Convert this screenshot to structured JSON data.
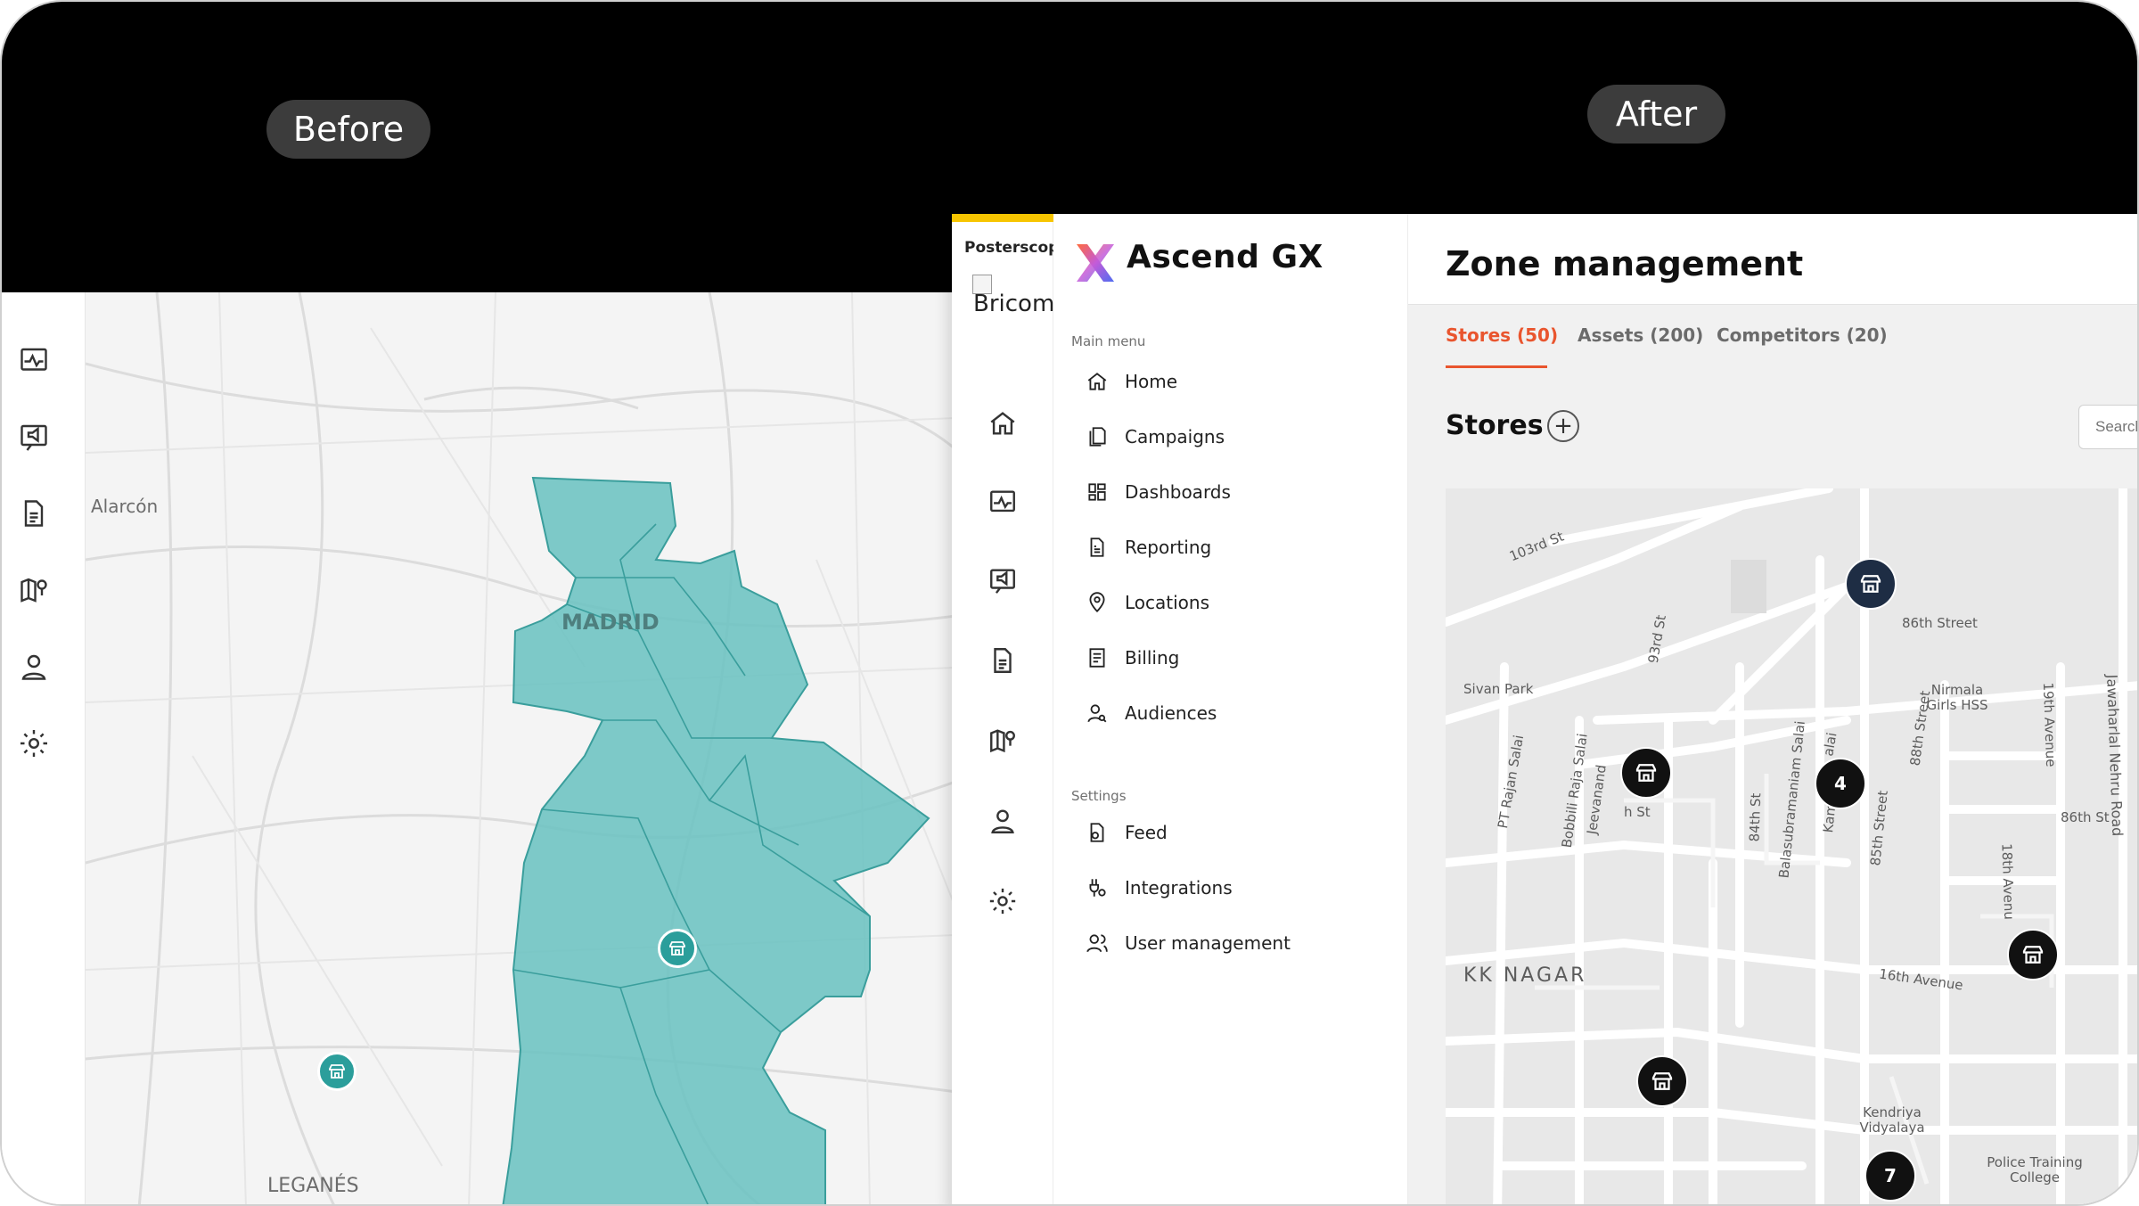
{
  "labels": {
    "before": "Before",
    "after": "After"
  },
  "before_map": {
    "places": {
      "alarcon": "Alarcón",
      "madrid": "MADRID",
      "leganes": "LEGANÉS"
    }
  },
  "brand": {
    "posterscope": "Posterscope",
    "bricom": "Bricom"
  },
  "app": {
    "title": "Ascend GX"
  },
  "menu": {
    "main_label": "Main menu",
    "main_items": [
      {
        "label": "Home",
        "icon": "home-icon"
      },
      {
        "label": "Campaigns",
        "icon": "campaigns-icon"
      },
      {
        "label": "Dashboards",
        "icon": "dashboards-icon"
      },
      {
        "label": "Reporting",
        "icon": "reporting-icon"
      },
      {
        "label": "Locations",
        "icon": "location-pin-icon"
      },
      {
        "label": "Billing",
        "icon": "billing-icon"
      },
      {
        "label": "Audiences",
        "icon": "audiences-icon"
      }
    ],
    "settings_label": "Settings",
    "settings_items": [
      {
        "label": "Feed",
        "icon": "feed-icon"
      },
      {
        "label": "Integrations",
        "icon": "integrations-icon"
      },
      {
        "label": "User management",
        "icon": "user-management-icon"
      }
    ]
  },
  "page": {
    "title": "Zone management",
    "tabs": [
      "Stores (50)",
      "Assets (200)",
      "Competitors (20)"
    ],
    "active_tab": "Stores (50)",
    "stores_heading": "Stores",
    "add_symbol": "+",
    "search_placeholder": "Search"
  },
  "zone_map": {
    "streets": {
      "s103": "103rd St",
      "s86a": "86th Street",
      "sivan": "Sivan Park",
      "nirmala": "Nirmala Girls HSS",
      "s93": "93rd St",
      "s88": "88th Street",
      "s19": "19th Avenue",
      "jawaharlal": "Jawaharlal Nehru Road",
      "s86b": "86th St",
      "ptrajan": "PT Rajan Salai",
      "bobbili": "Bobbili Raja Salai",
      "jeevanand": "Jeevanand",
      "s84": "84th St",
      "bala": "Balasubramaniam Salai",
      "kama": "Kama",
      "s85": "85th Street",
      "s18": "18th Avenu",
      "kknagar": "KK NAGAR",
      "s16": "16th Avenue",
      "kendriya": "Kendriya Vidyalaya",
      "police": "Police Training College",
      "st": "h St",
      "salai": "alai"
    },
    "cluster_counts": {
      "a": "4",
      "b": "7"
    }
  },
  "colors": {
    "accent": "#e9552e",
    "zone_fill": "#6cc3c2",
    "brand_yellow": "#f7c500"
  }
}
